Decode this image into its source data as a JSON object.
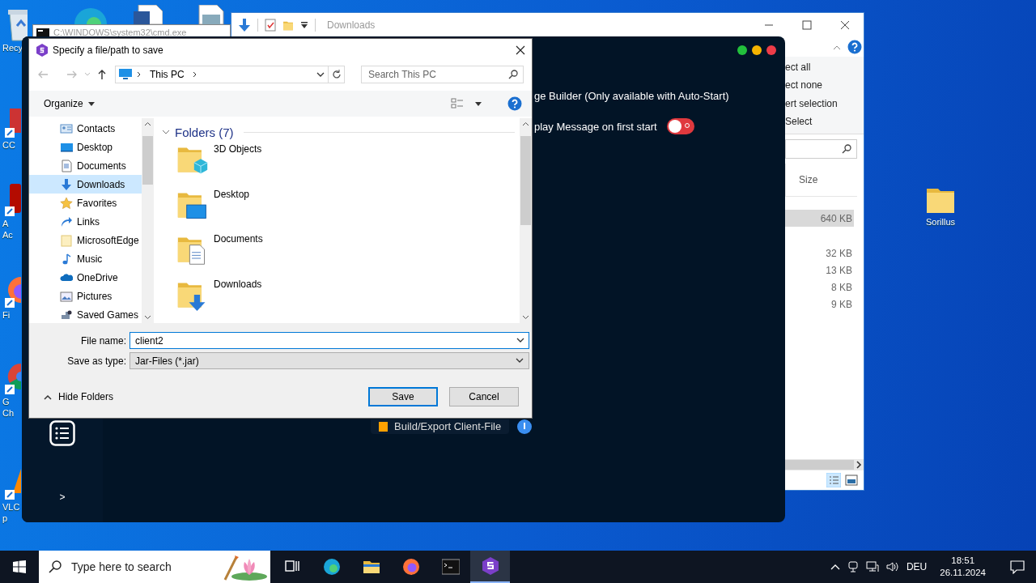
{
  "desktop_icons_top": [
    {
      "kind": "edge"
    },
    {
      "kind": "word"
    },
    {
      "kind": "document"
    }
  ],
  "desktop_icons_left": [
    {
      "kind": "recycle",
      "lines": [
        "Recy"
      ]
    },
    {
      "kind": "cc",
      "lines": [
        "CC"
      ]
    },
    {
      "kind": "acrobat",
      "lines": [
        "A",
        "Ac"
      ]
    },
    {
      "kind": "firefox",
      "lines": [
        "Fi"
      ]
    },
    {
      "kind": "chrome",
      "lines": [
        "G",
        "Ch"
      ]
    },
    {
      "kind": "vlc",
      "lines": [
        "VLC",
        "p"
      ]
    }
  ],
  "desktop_icons_right": [
    {
      "kind": "folder",
      "label": "Sorillus"
    }
  ],
  "explorer": {
    "title": "Downloads",
    "ribbon": [
      "ect all",
      "ect none",
      "ert selection",
      "Select"
    ],
    "column": "Size",
    "rows": [
      {
        "size": "640 KB",
        "selected": true
      },
      {
        "size": "32 KB",
        "selected": false
      },
      {
        "size": "13 KB",
        "selected": false
      },
      {
        "size": "8 KB",
        "selected": false
      },
      {
        "size": "9 KB",
        "selected": false
      }
    ]
  },
  "console": {
    "title": "C:\\WINDOWS\\system32\\cmd.exe"
  },
  "app": {
    "options": [
      {
        "kind": "text",
        "label": "ge Builder (Only available with Auto-Start)"
      },
      {
        "kind": "toggle",
        "label": "play Message on first start",
        "on": false
      }
    ],
    "build_button": "Build/Export Client-File",
    "prompt": ">"
  },
  "dialog": {
    "title": "Specify a file/path to save",
    "address": "This PC",
    "search_placeholder": "Search This PC",
    "organize": "Organize",
    "tree": [
      {
        "kind": "contacts",
        "label": "Contacts",
        "selected": false
      },
      {
        "kind": "desktop",
        "label": "Desktop",
        "selected": false
      },
      {
        "kind": "documents",
        "label": "Documents",
        "selected": false
      },
      {
        "kind": "downloads",
        "label": "Downloads",
        "selected": true
      },
      {
        "kind": "favorites",
        "label": "Favorites",
        "selected": false
      },
      {
        "kind": "links",
        "label": "Links",
        "selected": false
      },
      {
        "kind": "folder",
        "label": "MicrosoftEdge",
        "selected": false
      },
      {
        "kind": "music",
        "label": "Music",
        "selected": false
      },
      {
        "kind": "onedrive",
        "label": "OneDrive",
        "selected": false
      },
      {
        "kind": "pictures",
        "label": "Pictures",
        "selected": false
      },
      {
        "kind": "games",
        "label": "Saved Games",
        "selected": false
      }
    ],
    "group": "Folders (7)",
    "folders": [
      {
        "kind": "cube",
        "label": "3D Objects"
      },
      {
        "kind": "desktop",
        "label": "Desktop"
      },
      {
        "kind": "document",
        "label": "Documents"
      },
      {
        "kind": "download",
        "label": "Downloads"
      }
    ],
    "file_name_label": "File name:",
    "file_name": "client2",
    "type_label": "Save as type:",
    "type": "Jar-Files (*.jar)",
    "hide_folders": "Hide Folders",
    "buttons": [
      "Save",
      "Cancel"
    ]
  },
  "taskbar": {
    "search_placeholder": "Type here to search",
    "apps": [
      {
        "kind": "taskview",
        "active": false
      },
      {
        "kind": "edge",
        "active": false
      },
      {
        "kind": "explorer",
        "active": false
      },
      {
        "kind": "firefox",
        "active": false
      },
      {
        "kind": "console",
        "active": false
      },
      {
        "kind": "sorillus",
        "active": true
      }
    ],
    "language": "DEU",
    "time": "18:51",
    "date": "26.11.2024"
  }
}
